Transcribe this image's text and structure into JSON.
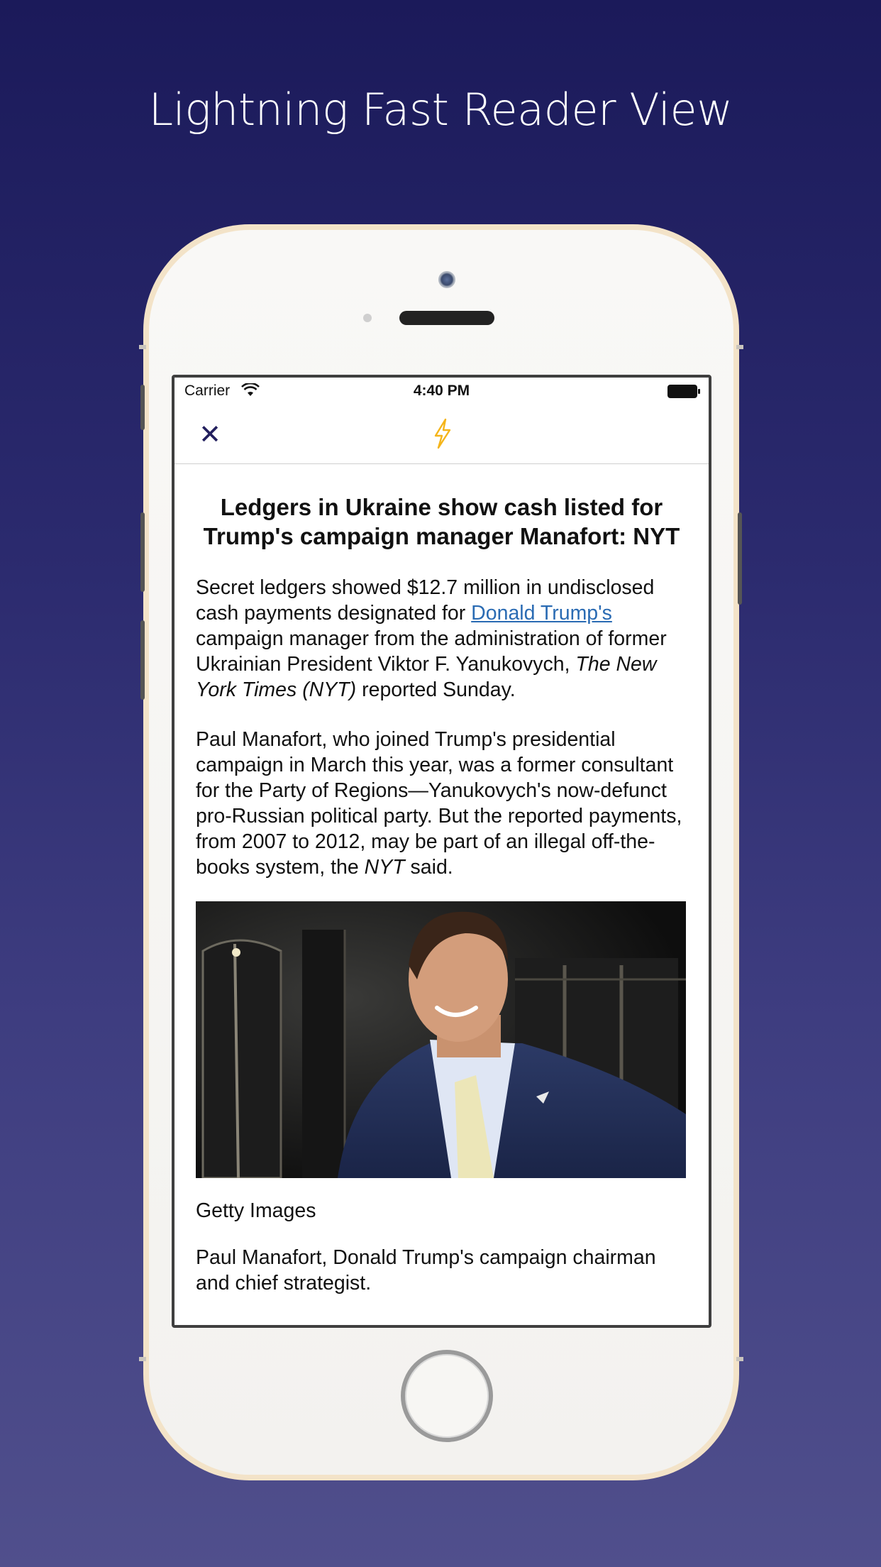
{
  "promo": {
    "headline": "Lightning Fast Reader View"
  },
  "status_bar": {
    "carrier": "Carrier",
    "time": "4:40 PM"
  },
  "nav": {
    "close_icon": "close-icon",
    "reader_icon": "lightning-icon",
    "accent_color": "#f5b51a"
  },
  "article": {
    "title": "Ledgers in Ukraine show cash listed for Trump's campaign manager Manafort: NYT",
    "p1_a": "Secret ledgers showed $12.7 million in undisclosed cash payments designated for ",
    "p1_link": "Donald Trump's",
    "p1_b": " campaign manager from the administration of former Ukrainian President Viktor F. Yanukovych, ",
    "p1_em": "The New York Times (NYT)",
    "p1_c": " reported Sunday.",
    "p2_a": "Paul Manafort, who joined Trump's presidential campaign in March this year, was a former consultant for the Party of Regions—Yanukovych's now-defunct pro-Russian political party. But the reported payments, from 2007 to 2012, may be part of an illegal off-the-books system, the ",
    "p2_em": "NYT",
    "p2_b": " said.",
    "photo_credit": "Getty Images",
    "photo_caption": "Paul Manafort, Donald Trump's campaign chairman and chief strategist."
  }
}
